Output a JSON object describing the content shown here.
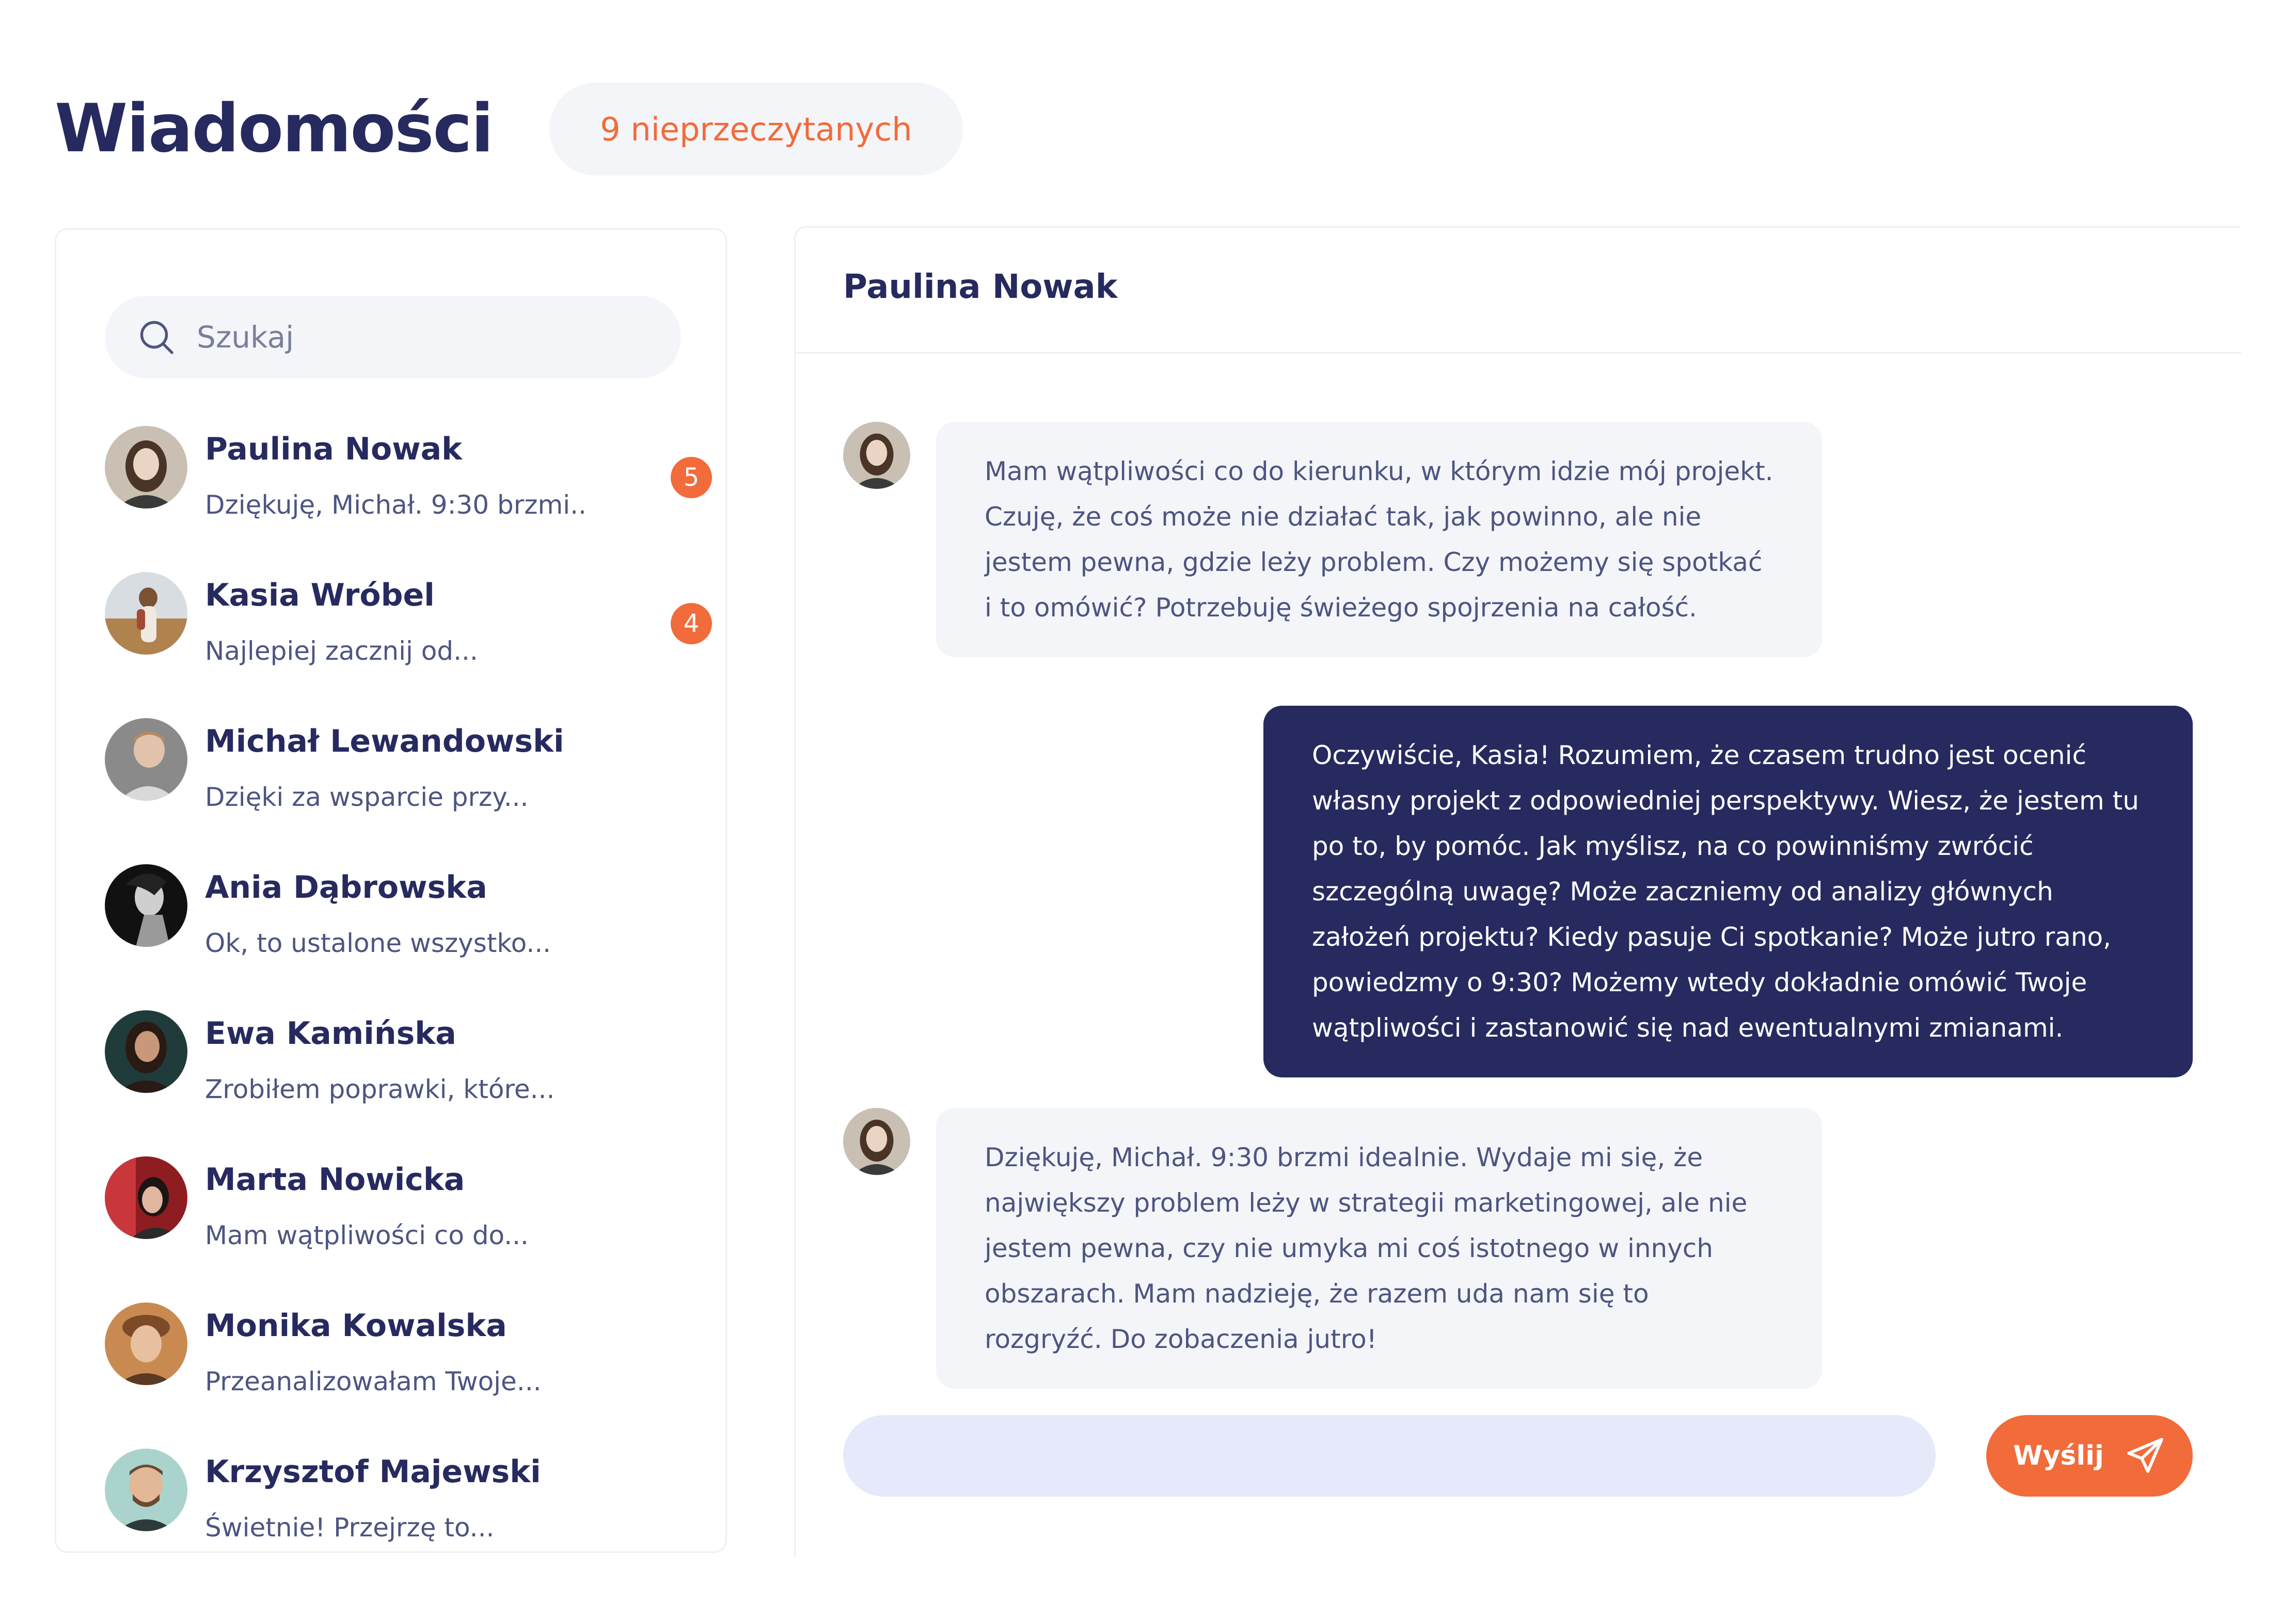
{
  "header": {
    "title": "Wiadomości",
    "unread_label": "9 nieprzeczytanych"
  },
  "colors": {
    "accent": "#f26b3a",
    "primary": "#262a5f",
    "bubble_incoming": "#f4f5f9",
    "compose_bg": "#e5e9fa"
  },
  "sidebar": {
    "search": {
      "icon": "search-icon",
      "placeholder": "Szukaj"
    },
    "conversations": [
      {
        "name": "Paulina Nowak",
        "preview": "Dziękuję, Michał. 9:30 brzmi..",
        "unread": "5"
      },
      {
        "name": "Kasia Wróbel",
        "preview": "Najlepiej zacznij od...",
        "unread": "4"
      },
      {
        "name": "Michał Lewandowski",
        "preview": "Dzięki za wsparcie przy..."
      },
      {
        "name": "Ania Dąbrowska",
        "preview": "Ok, to ustalone wszystko..."
      },
      {
        "name": "Ewa Kamińska",
        "preview": "Zrobiłem poprawki, które..."
      },
      {
        "name": "Marta Nowicka",
        "preview": "Mam wątpliwości co do..."
      },
      {
        "name": "Monika Kowalska",
        "preview": "Przeanalizowałam Twoje..."
      },
      {
        "name": "Krzysztof Majewski",
        "preview": "Świetnie! Przejrzę to..."
      }
    ]
  },
  "chat": {
    "title": "Paulina Nowak",
    "messages": [
      {
        "direction": "incoming",
        "text": "Mam wątpliwości co do kierunku, w którym idzie mój projekt. Czuję, że coś może nie działać tak, jak powinno, ale nie jestem pewna, gdzie leży problem. Czy możemy się spotkać i to omówić? Potrzebuję świeżego spojrzenia na całość."
      },
      {
        "direction": "outgoing",
        "text": "Oczywiście, Kasia! Rozumiem, że czasem trudno jest ocenić własny projekt z odpowiedniej perspektywy. Wiesz, że jestem tu po to, by pomóc. Jak myślisz, na co powinniśmy zwrócić szczególną uwagę? Może zaczniemy od analizy głównych założeń projektu? Kiedy pasuje Ci spotkanie? Może jutro rano, powiedzmy o 9:30? Możemy wtedy dokładnie omówić Twoje wątpliwości i zastanowić się nad ewentualnymi zmianami."
      },
      {
        "direction": "incoming",
        "text": "Dziękuję, Michał. 9:30 brzmi idealnie. Wydaje mi się, że największy problem leży w strategii marketingowej, ale nie jestem pewna, czy nie umyka mi coś istotnego w innych obszarach. Mam nadzieję, że razem uda nam się to rozgryźć. Do zobaczenia jutro!"
      }
    ],
    "compose": {
      "value": "",
      "send_label": "Wyślij",
      "send_icon": "send-icon"
    }
  }
}
